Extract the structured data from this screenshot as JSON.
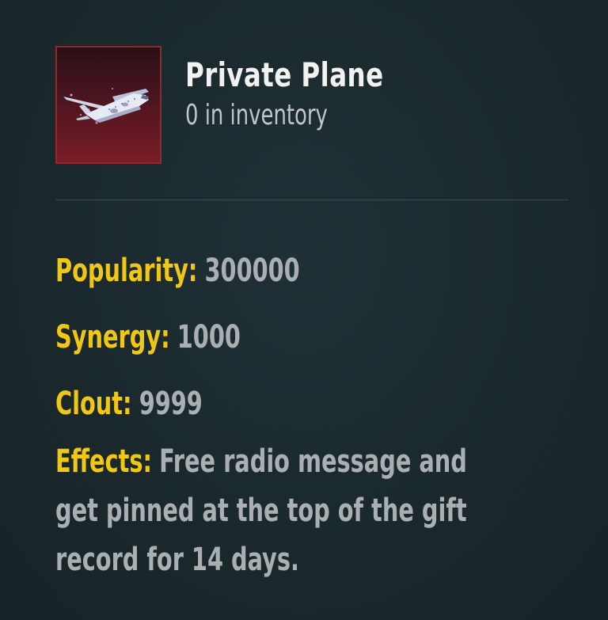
{
  "item": {
    "name": "Private Plane",
    "inventory": "0 in inventory",
    "icon": "private-plane-icon",
    "frame_color": "#8d2a2c"
  },
  "stats": {
    "popularity_label": "Popularity:",
    "popularity_value": "300000",
    "synergy_label": "Synergy:",
    "synergy_value": "1000",
    "clout_label": "Clout:",
    "clout_value": "9999",
    "effects_label": "Effects:",
    "effects_lines": [
      "Free radio message and",
      "get pinned at the top of the gift",
      "record for 14 days."
    ]
  },
  "colors": {
    "label": "#f0c814",
    "value": "#aab0b1",
    "title": "#f2f2f0",
    "background": "#1b2a2f"
  }
}
